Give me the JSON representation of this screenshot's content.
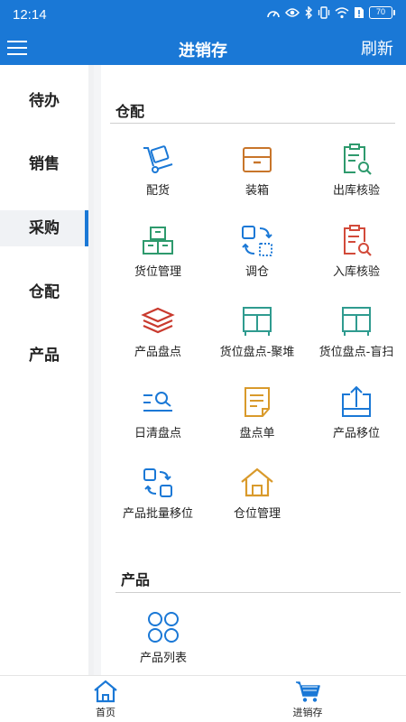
{
  "status_bar": {
    "time": "12:14",
    "battery": "70"
  },
  "app_bar": {
    "title": "进销存",
    "refresh_label": "刷新"
  },
  "sidebar": {
    "items": [
      {
        "label": "待办",
        "active": false
      },
      {
        "label": "销售",
        "active": false
      },
      {
        "label": "采购",
        "active": true
      },
      {
        "label": "仓配",
        "active": false
      },
      {
        "label": "产品",
        "active": false
      }
    ]
  },
  "sections": [
    {
      "title": "仓配",
      "items": [
        {
          "label": "配货",
          "icon": "dolly-icon"
        },
        {
          "label": "装箱",
          "icon": "box-icon"
        },
        {
          "label": "出库核验",
          "icon": "outbound-check-icon"
        },
        {
          "label": "货位管理",
          "icon": "stacked-boxes-icon"
        },
        {
          "label": "调仓",
          "icon": "transfer-icon"
        },
        {
          "label": "入库核验",
          "icon": "inbound-check-icon"
        },
        {
          "label": "产品盘点",
          "icon": "layers-icon"
        },
        {
          "label": "货位盘点-聚堆",
          "icon": "shelf-icon"
        },
        {
          "label": "货位盘点-盲扫",
          "icon": "shelf-scan-icon"
        },
        {
          "label": "日清盘点",
          "icon": "list-search-icon"
        },
        {
          "label": "盘点单",
          "icon": "document-icon"
        },
        {
          "label": "产品移位",
          "icon": "tray-upload-icon"
        },
        {
          "label": "产品批量移位",
          "icon": "batch-move-icon"
        },
        {
          "label": "仓位管理",
          "icon": "warehouse-icon"
        }
      ]
    },
    {
      "title": "产品",
      "items": [
        {
          "label": "产品列表",
          "icon": "grid-circles-icon"
        }
      ]
    }
  ],
  "bottom_nav": {
    "tabs": [
      {
        "label": "首页",
        "icon": "home-icon"
      },
      {
        "label": "进销存",
        "icon": "cart-icon"
      }
    ]
  },
  "colors": {
    "primary": "#1a78d6",
    "orange": "#c8752a",
    "green": "#2e9a6d",
    "red": "#d24a3a",
    "teal": "#2f9b8f"
  }
}
